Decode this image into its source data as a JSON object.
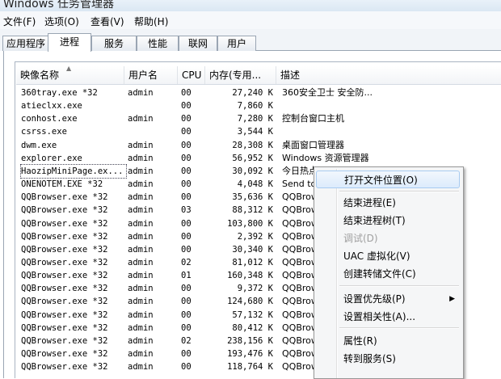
{
  "window": {
    "title": "Windows 任务管理器"
  },
  "menubar": [
    {
      "label": "文件(F)"
    },
    {
      "label": "选项(O)"
    },
    {
      "label": "查看(V)"
    },
    {
      "label": "帮助(H)"
    }
  ],
  "tabs": [
    {
      "label": "应用程序",
      "active": false
    },
    {
      "label": "进程",
      "active": true
    },
    {
      "label": "服务",
      "active": false
    },
    {
      "label": "性能",
      "active": false
    },
    {
      "label": "联网",
      "active": false
    },
    {
      "label": "用户",
      "active": false
    }
  ],
  "columns": {
    "name": "映像名称",
    "user": "用户名",
    "cpu": "CPU",
    "mem": "内存(专用...",
    "desc": "描述"
  },
  "rows": [
    {
      "name": "360tray.exe *32",
      "user": "admin",
      "cpu": "00",
      "mem": "27,240 K",
      "desc": "360安全卫士 安全防..."
    },
    {
      "name": "atieclxx.exe",
      "user": "",
      "cpu": "00",
      "mem": "7,860 K",
      "desc": ""
    },
    {
      "name": "conhost.exe",
      "user": "admin",
      "cpu": "00",
      "mem": "7,280 K",
      "desc": "控制台窗口主机"
    },
    {
      "name": "csrss.exe",
      "user": "",
      "cpu": "00",
      "mem": "3,544 K",
      "desc": ""
    },
    {
      "name": "dwm.exe",
      "user": "admin",
      "cpu": "00",
      "mem": "28,308 K",
      "desc": "桌面窗口管理器"
    },
    {
      "name": "explorer.exe",
      "user": "admin",
      "cpu": "00",
      "mem": "56,952 K",
      "desc": "Windows 资源管理器"
    },
    {
      "name": "HaozipMiniPage.ex...",
      "user": "admin",
      "cpu": "00",
      "mem": "30,092 K",
      "desc": "今日热点",
      "selected": true
    },
    {
      "name": "ONENOTEM.EXE *32",
      "user": "admin",
      "cpu": "00",
      "mem": "4,048 K",
      "desc": "Send to"
    },
    {
      "name": "QQBrowser.exe *32",
      "user": "admin",
      "cpu": "00",
      "mem": "35,636 K",
      "desc": "QQBrows"
    },
    {
      "name": "QQBrowser.exe *32",
      "user": "admin",
      "cpu": "03",
      "mem": "88,312 K",
      "desc": "QQBrows"
    },
    {
      "name": "QQBrowser.exe *32",
      "user": "admin",
      "cpu": "00",
      "mem": "103,800 K",
      "desc": "QQBrows"
    },
    {
      "name": "QQBrowser.exe *32",
      "user": "admin",
      "cpu": "00",
      "mem": "2,392 K",
      "desc": "QQBrows"
    },
    {
      "name": "QQBrowser.exe *32",
      "user": "admin",
      "cpu": "00",
      "mem": "30,340 K",
      "desc": "QQBrows"
    },
    {
      "name": "QQBrowser.exe *32",
      "user": "admin",
      "cpu": "02",
      "mem": "81,012 K",
      "desc": "QQBrows"
    },
    {
      "name": "QQBrowser.exe *32",
      "user": "admin",
      "cpu": "01",
      "mem": "160,348 K",
      "desc": "QQBrows"
    },
    {
      "name": "QQBrowser.exe *32",
      "user": "admin",
      "cpu": "00",
      "mem": "9,372 K",
      "desc": "QQBrows"
    },
    {
      "name": "QQBrowser.exe *32",
      "user": "admin",
      "cpu": "00",
      "mem": "124,680 K",
      "desc": "QQBrows"
    },
    {
      "name": "QQBrowser.exe *32",
      "user": "admin",
      "cpu": "00",
      "mem": "57,132 K",
      "desc": "QQBrows"
    },
    {
      "name": "QQBrowser.exe *32",
      "user": "admin",
      "cpu": "00",
      "mem": "80,412 K",
      "desc": "QQBrows"
    },
    {
      "name": "QQBrowser.exe *32",
      "user": "admin",
      "cpu": "02",
      "mem": "238,156 K",
      "desc": "QQBrows"
    },
    {
      "name": "QQBrowser.exe *32",
      "user": "admin",
      "cpu": "00",
      "mem": "193,476 K",
      "desc": "QQBrows"
    },
    {
      "name": "QQBrowser.exe *32",
      "user": "admin",
      "cpu": "00",
      "mem": "118,764 K",
      "desc": "QQBrows"
    }
  ],
  "context_menu": {
    "items": [
      {
        "label": "打开文件位置(O)",
        "highlighted": true
      },
      {
        "separator": true
      },
      {
        "label": "结束进程(E)"
      },
      {
        "label": "结束进程树(T)"
      },
      {
        "label": "调试(D)",
        "disabled": true
      },
      {
        "label": "UAC 虚拟化(V)"
      },
      {
        "label": "创建转储文件(C)"
      },
      {
        "separator": true
      },
      {
        "label": "设置优先级(P)",
        "submenu": true
      },
      {
        "label": "设置相关性(A)..."
      },
      {
        "separator": true
      },
      {
        "label": "属性(R)"
      },
      {
        "label": "转到服务(S)"
      }
    ]
  },
  "colors": {
    "menu_highlight_border": "#a8cbf1",
    "menu_background": "#f5f6f7",
    "disabled_text": "#a0a0a0"
  }
}
